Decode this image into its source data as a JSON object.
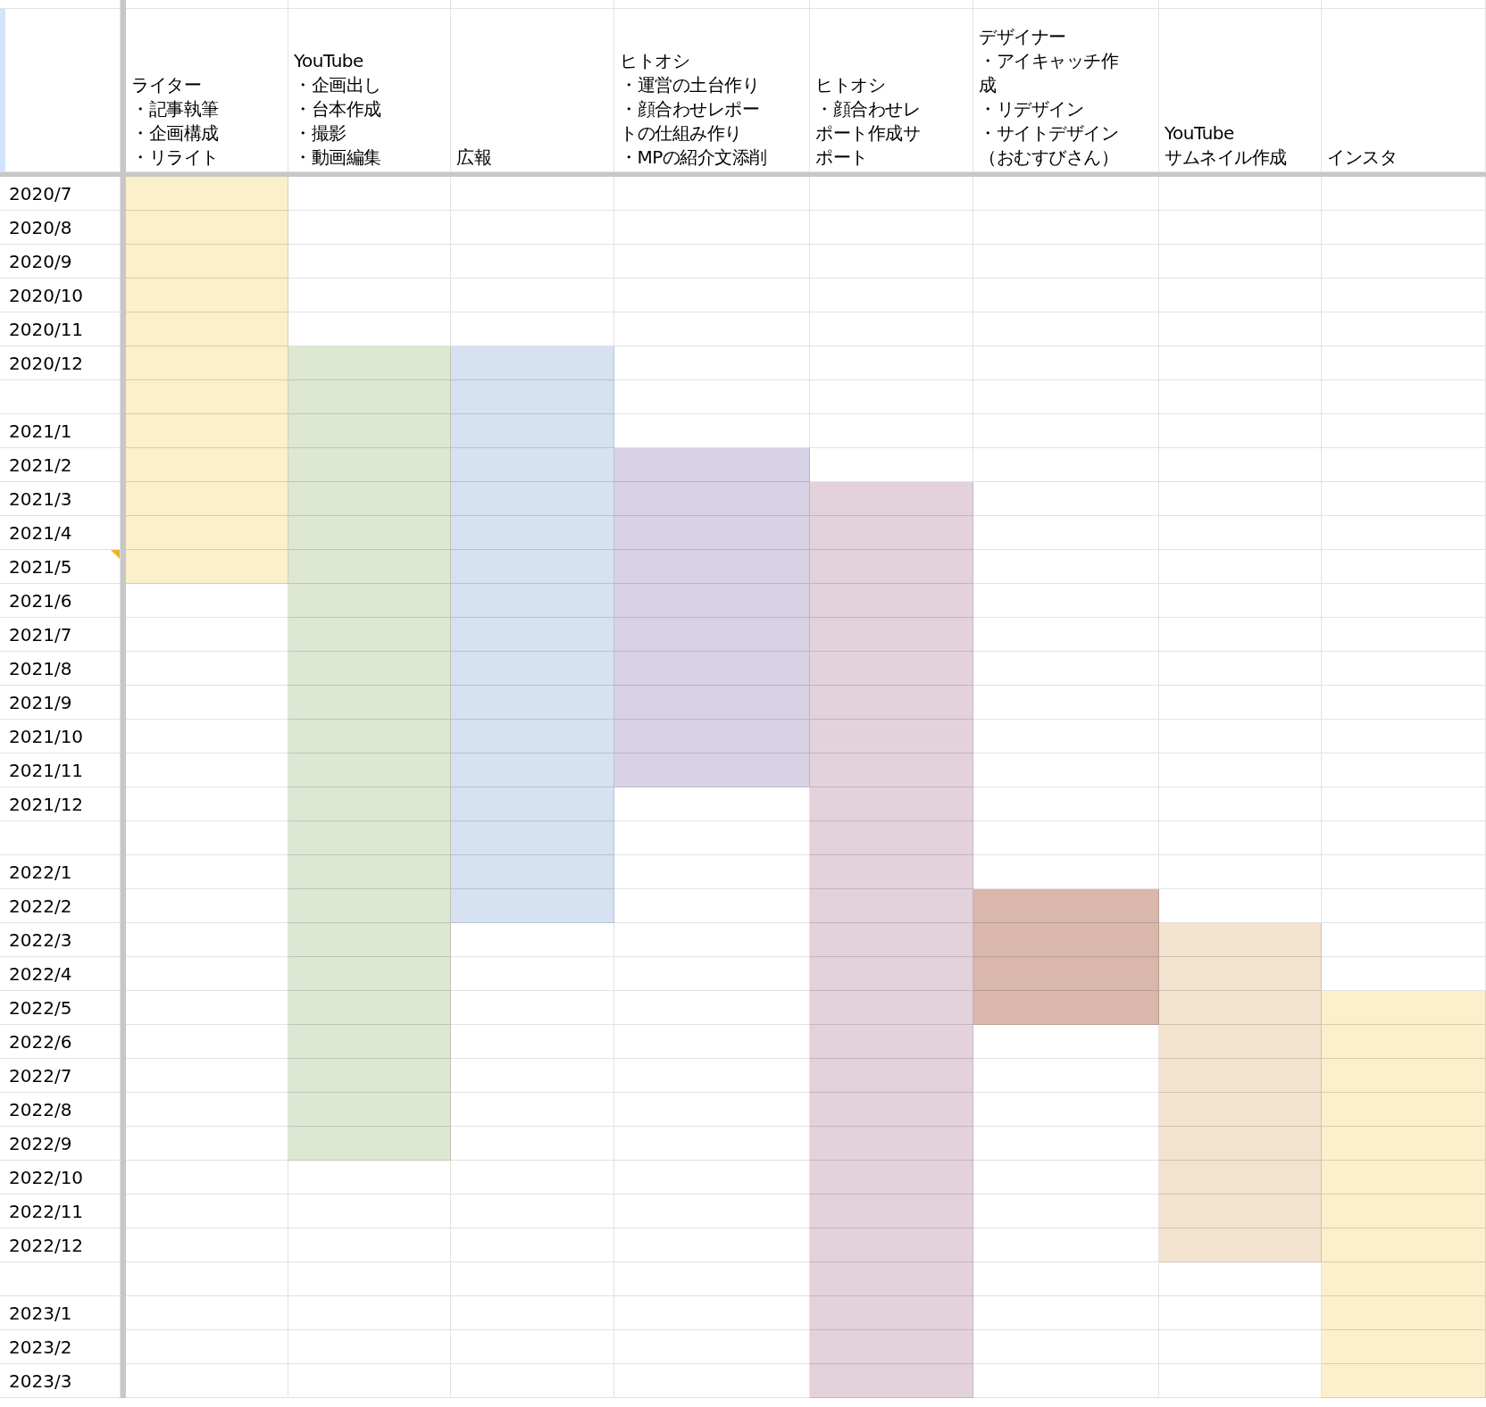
{
  "columns": [
    {
      "lines": [
        "ライター",
        "・記事執筆",
        "・企画構成",
        "・リライト"
      ],
      "color": "#fbf0cb"
    },
    {
      "lines": [
        "YouTube",
        "・企画出し",
        "・台本作成",
        "・撮影",
        "・動画編集"
      ],
      "color": "#dde7d2"
    },
    {
      "lines": [
        "広報"
      ],
      "color": "#d6e1f1"
    },
    {
      "lines": [
        "ヒトオシ",
        "・運営の土台作り",
        "・顔合わせレポー",
        "トの仕組み作り",
        "・MPの紹介文添削"
      ],
      "color": "#d8d2e6"
    },
    {
      "lines": [
        "ヒトオシ",
        "・顔合わせレ",
        "ポート作成サ",
        "ポート"
      ],
      "color": "#e3d2db"
    },
    {
      "lines": [
        "デザイナー",
        "・アイキャッチ作",
        "成",
        "・リデザイン",
        "・サイトデザイン",
        "（おむすびさん）"
      ],
      "color": "#d9b7ab"
    },
    {
      "lines": [
        "YouTube",
        "サムネイル作成"
      ],
      "color": "#f3e2cd"
    },
    {
      "lines": [
        "インスタ"
      ],
      "color": "#fbf0cb"
    }
  ],
  "rows": [
    {
      "label": "2020/7",
      "filled": [
        true,
        false,
        false,
        false,
        false,
        false,
        false,
        false
      ]
    },
    {
      "label": "2020/8",
      "filled": [
        true,
        false,
        false,
        false,
        false,
        false,
        false,
        false
      ]
    },
    {
      "label": "2020/9",
      "filled": [
        true,
        false,
        false,
        false,
        false,
        false,
        false,
        false
      ]
    },
    {
      "label": "2020/10",
      "filled": [
        true,
        false,
        false,
        false,
        false,
        false,
        false,
        false
      ]
    },
    {
      "label": "2020/11",
      "filled": [
        true,
        false,
        false,
        false,
        false,
        false,
        false,
        false
      ]
    },
    {
      "label": "2020/12",
      "filled": [
        true,
        true,
        true,
        false,
        false,
        false,
        false,
        false
      ]
    },
    {
      "filled": [
        true,
        true,
        true,
        false,
        false,
        false,
        false,
        false
      ]
    },
    {
      "label": "2021/1",
      "filled": [
        true,
        true,
        true,
        false,
        false,
        false,
        false,
        false
      ]
    },
    {
      "label": "2021/2",
      "filled": [
        true,
        true,
        true,
        true,
        false,
        false,
        false,
        false
      ]
    },
    {
      "label": "2021/3",
      "filled": [
        true,
        true,
        true,
        true,
        true,
        false,
        false,
        false
      ]
    },
    {
      "label": "2021/4",
      "filled": [
        true,
        true,
        true,
        true,
        true,
        false,
        false,
        false
      ]
    },
    {
      "label": "2021/5",
      "comment": true,
      "filled": [
        true,
        true,
        true,
        true,
        true,
        false,
        false,
        false
      ]
    },
    {
      "label": "2021/6",
      "filled": [
        false,
        true,
        true,
        true,
        true,
        false,
        false,
        false
      ]
    },
    {
      "label": "2021/7",
      "filled": [
        false,
        true,
        true,
        true,
        true,
        false,
        false,
        false
      ]
    },
    {
      "label": "2021/8",
      "filled": [
        false,
        true,
        true,
        true,
        true,
        false,
        false,
        false
      ]
    },
    {
      "label": "2021/9",
      "filled": [
        false,
        true,
        true,
        true,
        true,
        false,
        false,
        false
      ]
    },
    {
      "label": "2021/10",
      "filled": [
        false,
        true,
        true,
        true,
        true,
        false,
        false,
        false
      ]
    },
    {
      "label": "2021/11",
      "filled": [
        false,
        true,
        true,
        true,
        true,
        false,
        false,
        false
      ]
    },
    {
      "label": "2021/12",
      "filled": [
        false,
        true,
        true,
        false,
        true,
        false,
        false,
        false
      ]
    },
    {
      "filled": [
        false,
        true,
        true,
        false,
        true,
        false,
        false,
        false
      ]
    },
    {
      "label": "2022/1",
      "filled": [
        false,
        true,
        true,
        false,
        true,
        false,
        false,
        false
      ]
    },
    {
      "label": "2022/2",
      "filled": [
        false,
        true,
        true,
        false,
        true,
        true,
        false,
        false
      ]
    },
    {
      "label": "2022/3",
      "filled": [
        false,
        true,
        false,
        false,
        true,
        true,
        true,
        false
      ]
    },
    {
      "label": "2022/4",
      "filled": [
        false,
        true,
        false,
        false,
        true,
        true,
        true,
        false
      ]
    },
    {
      "label": "2022/5",
      "filled": [
        false,
        true,
        false,
        false,
        true,
        true,
        true,
        true
      ]
    },
    {
      "label": "2022/6",
      "filled": [
        false,
        true,
        false,
        false,
        true,
        false,
        true,
        true
      ]
    },
    {
      "label": "2022/7",
      "filled": [
        false,
        true,
        false,
        false,
        true,
        false,
        true,
        true
      ]
    },
    {
      "label": "2022/8",
      "filled": [
        false,
        true,
        false,
        false,
        true,
        false,
        true,
        true
      ]
    },
    {
      "label": "2022/9",
      "filled": [
        false,
        true,
        false,
        false,
        true,
        false,
        true,
        true
      ]
    },
    {
      "label": "2022/10",
      "filled": [
        false,
        false,
        false,
        false,
        true,
        false,
        true,
        true
      ]
    },
    {
      "label": "2022/11",
      "filled": [
        false,
        false,
        false,
        false,
        true,
        false,
        true,
        true
      ]
    },
    {
      "label": "2022/12",
      "filled": [
        false,
        false,
        false,
        false,
        true,
        false,
        true,
        true
      ]
    },
    {
      "filled": [
        false,
        false,
        false,
        false,
        true,
        false,
        false,
        true
      ]
    },
    {
      "label": "2023/1",
      "filled": [
        false,
        false,
        false,
        false,
        true,
        false,
        false,
        true
      ]
    },
    {
      "label": "2023/2",
      "filled": [
        false,
        false,
        false,
        false,
        true,
        false,
        false,
        true
      ]
    },
    {
      "label": "2023/3",
      "filled": [
        false,
        false,
        false,
        false,
        true,
        false,
        false,
        true
      ]
    }
  ]
}
